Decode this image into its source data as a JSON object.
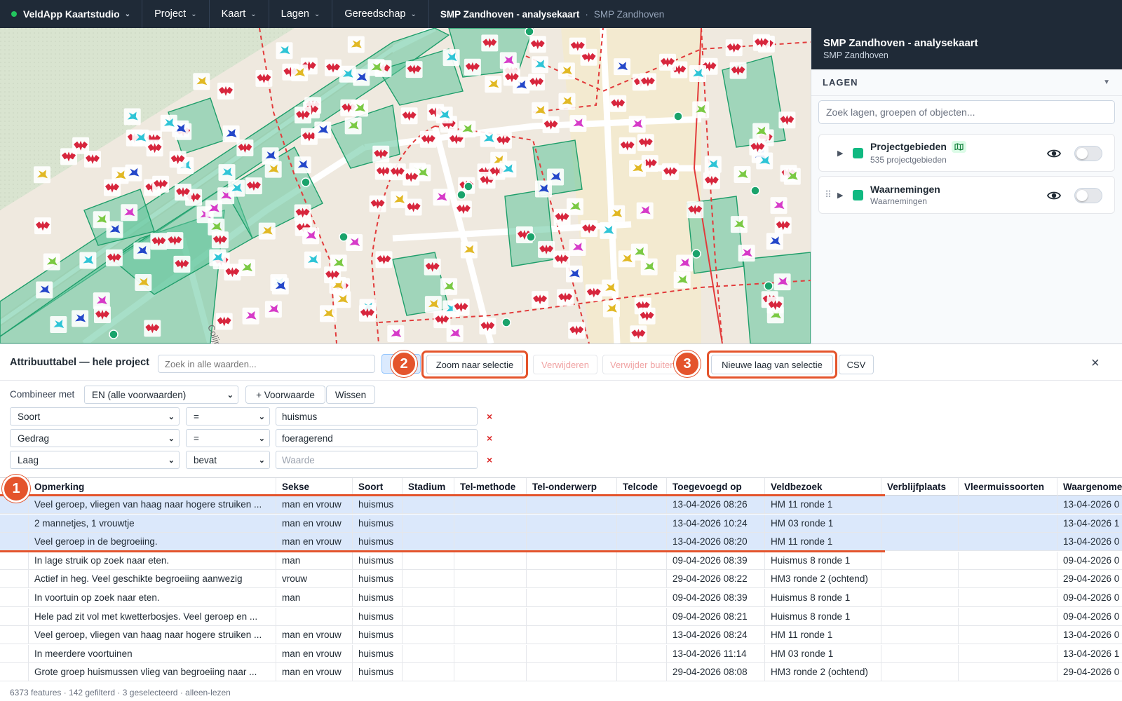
{
  "topbar": {
    "brand": "VeldApp Kaartstudio",
    "menus": [
      "Project",
      "Kaart",
      "Lagen",
      "Gereedschap"
    ],
    "breadcrumb_title": "SMP Zandhoven - analysekaart",
    "breadcrumb_separator": "·",
    "breadcrumb_sub": "SMP Zandhoven"
  },
  "map": {
    "street_label": "Colijnstraat",
    "colors": {
      "background": "#efe9df",
      "area_fill": "#5ec49a",
      "area_stroke": "#1e9e6a",
      "boundary": "#e23b3b",
      "marker_red": "#d7263d",
      "marker_cyan": "#2ec4d6",
      "marker_pink": "#d63ac8",
      "marker_yellow": "#e1b824",
      "marker_green": "#7ac943",
      "marker_blue": "#2447c9"
    },
    "icons": [
      "bat-marker-icon",
      "bird-marker-icon",
      "house-marker-icon",
      "dot-marker-icon"
    ]
  },
  "sidepanel": {
    "title": "SMP Zandhoven - analysekaart",
    "subtitle": "SMP Zandhoven",
    "layers_heading": "LAGEN",
    "search_placeholder": "Zoek lagen, groepen of objecten...",
    "layers": [
      {
        "name": "Projectgebieden",
        "subtitle": "535 projectgebieden",
        "color": "#10b981"
      },
      {
        "name": "Waarnemingen",
        "subtitle": "Waarnemingen",
        "color": "#10b981"
      }
    ]
  },
  "attr": {
    "title": "Attribuuttabel — hele project",
    "search_placeholder": "Zoek in alle waarden...",
    "buttons": {
      "zoom": "Zoom naar selectie",
      "delete": "Verwijderen",
      "delete_outside": "Verwijder buiten",
      "new_layer": "Nieuwe laag van selectie",
      "csv": "CSV"
    },
    "badges": [
      "1",
      "2",
      "3"
    ],
    "combine_label": "Combineer met",
    "combine_value": "EN (alle voorwaarden)",
    "add_condition": "+ Voorwaarde",
    "clear": "Wissen",
    "filters": [
      {
        "field": "Soort",
        "op": "=",
        "value": "huismus",
        "placeholder": ""
      },
      {
        "field": "Gedrag",
        "op": "=",
        "value": "foeragerend",
        "placeholder": ""
      },
      {
        "field": "Laag",
        "op": "bevat",
        "value": "",
        "placeholder": "Waarde"
      }
    ],
    "remove": "×",
    "columns": [
      "Opmerking",
      "Sekse",
      "Soort",
      "Stadium",
      "Tel-methode",
      "Tel-onderwerp",
      "Telcode",
      "Toegevoegd op",
      "Veldbezoek",
      "Verblijfplaats",
      "Vleermuissoorten",
      "Waargenome"
    ],
    "rows": [
      {
        "selected": true,
        "cells": [
          "Veel geroep, vliegen van haag naar hogere struiken ...",
          "man en vrouw",
          "huismus",
          "",
          "",
          "",
          "",
          "13-04-2026 08:26",
          "HM 11 ronde 1",
          "",
          "",
          "13-04-2026 0"
        ]
      },
      {
        "selected": true,
        "cells": [
          "2 mannetjes, 1 vrouwtje",
          "man en vrouw",
          "huismus",
          "",
          "",
          "",
          "",
          "13-04-2026 10:24",
          "HM 03 ronde 1",
          "",
          "",
          "13-04-2026 1"
        ]
      },
      {
        "selected": true,
        "cells": [
          "Veel geroep in de begroeiing.",
          "man en vrouw",
          "huismus",
          "",
          "",
          "",
          "",
          "13-04-2026 08:20",
          "HM 11 ronde 1",
          "",
          "",
          "13-04-2026 0"
        ]
      },
      {
        "selected": false,
        "cells": [
          "In lage struik op zoek naar eten.",
          "man",
          "huismus",
          "",
          "",
          "",
          "",
          "09-04-2026 08:39",
          "Huismus 8 ronde 1",
          "",
          "",
          "09-04-2026 0"
        ]
      },
      {
        "selected": false,
        "cells": [
          "Actief in heg. Veel geschikte begroeiing aanwezig",
          "vrouw",
          "huismus",
          "",
          "",
          "",
          "",
          "29-04-2026 08:22",
          "HM3 ronde 2 (ochtend)",
          "",
          "",
          "29-04-2026 0"
        ]
      },
      {
        "selected": false,
        "cells": [
          "In voortuin op zoek naar eten.",
          "man",
          "huismus",
          "",
          "",
          "",
          "",
          "09-04-2026 08:39",
          "Huismus 8 ronde 1",
          "",
          "",
          "09-04-2026 0"
        ]
      },
      {
        "selected": false,
        "cells": [
          "Hele pad zit vol met kwetterbosjes. Veel geroep en ...",
          "",
          "huismus",
          "",
          "",
          "",
          "",
          "09-04-2026 08:21",
          "Huismus 8 ronde 1",
          "",
          "",
          "09-04-2026 0"
        ]
      },
      {
        "selected": false,
        "cells": [
          "Veel geroep, vliegen van haag naar hogere struiken ...",
          "man en vrouw",
          "huismus",
          "",
          "",
          "",
          "",
          "13-04-2026 08:24",
          "HM 11 ronde 1",
          "",
          "",
          "13-04-2026 0"
        ]
      },
      {
        "selected": false,
        "cells": [
          "In meerdere voortuinen",
          "man en vrouw",
          "huismus",
          "",
          "",
          "",
          "",
          "13-04-2026 11:14",
          "HM 03 ronde 1",
          "",
          "",
          "13-04-2026 1"
        ]
      },
      {
        "selected": false,
        "cells": [
          "Grote groep huismussen vlieg van begroeiing naar ...",
          "man en vrouw",
          "huismus",
          "",
          "",
          "",
          "",
          "29-04-2026 08:08",
          "HM3 ronde 2 (ochtend)",
          "",
          "",
          "29-04-2026 0"
        ]
      }
    ],
    "status": "6373 features · 142 gefilterd · 3 geselecteerd · alleen-lezen",
    "accent": "#e4542c",
    "selection_color": "#dbe8fb"
  }
}
